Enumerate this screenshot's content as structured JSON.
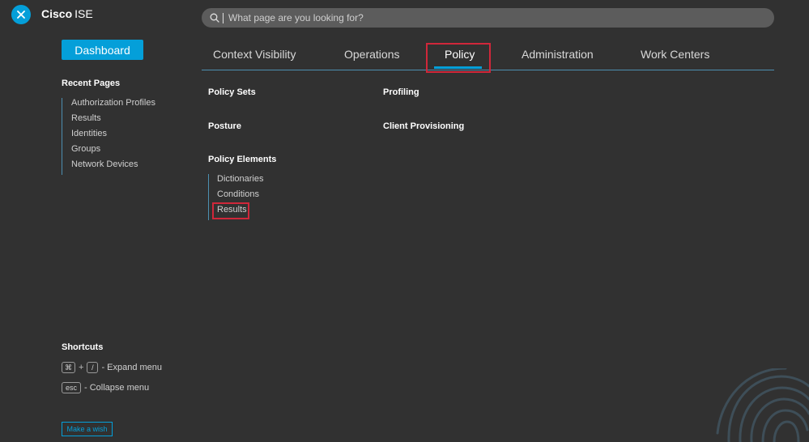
{
  "header": {
    "brand_primary": "Cisco",
    "brand_secondary": "ISE",
    "close_icon": "close-icon",
    "search": {
      "placeholder": "What page are you looking for?",
      "value": ""
    }
  },
  "sidebar": {
    "dashboard_label": "Dashboard",
    "recent_title": "Recent Pages",
    "recent_pages": [
      "Authorization Profiles",
      "Results",
      "Identities",
      "Groups",
      "Network Devices"
    ],
    "shortcuts_title": "Shortcuts",
    "shortcuts": [
      {
        "keys": [
          "⌘",
          "/"
        ],
        "label": "- Expand menu"
      },
      {
        "keys": [
          "esc"
        ],
        "label": "- Collapse menu"
      }
    ],
    "wish_label": "Make a wish"
  },
  "tabs": [
    {
      "label": "Context Visibility",
      "active": false
    },
    {
      "label": "Operations",
      "active": false
    },
    {
      "label": "Policy",
      "active": true
    },
    {
      "label": "Administration",
      "active": false
    },
    {
      "label": "Work Centers",
      "active": false
    }
  ],
  "menu": {
    "policy_sets": "Policy Sets",
    "posture": "Posture",
    "policy_elements": "Policy Elements",
    "policy_elements_items": [
      "Dictionaries",
      "Conditions",
      "Results"
    ],
    "profiling": "Profiling",
    "client_provisioning": "Client Provisioning"
  },
  "colors": {
    "background": "#313131",
    "accent": "#049fd9",
    "highlight": "#d0273a",
    "search_bg": "#5c5c5c"
  }
}
